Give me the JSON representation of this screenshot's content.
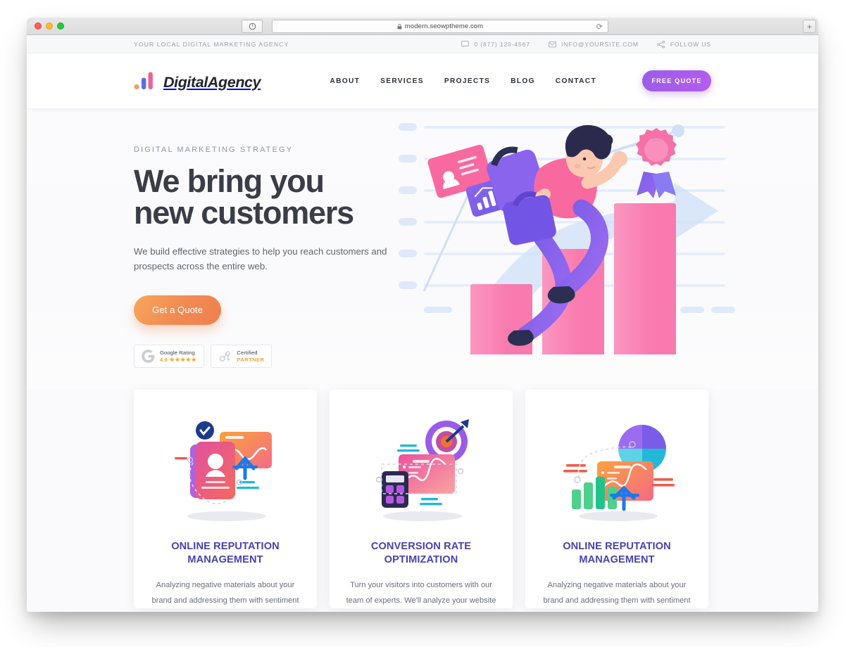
{
  "browser": {
    "url": "modern.seowptheme.com",
    "lock_icon": "lock-icon",
    "reload_icon": "reload-icon",
    "shield_icon": "shield-icon",
    "new_tab_label": "+"
  },
  "topbar": {
    "tagline": "YOUR LOCAL DIGITAL MARKETING AGENCY",
    "items": [
      {
        "icon": "chat-icon",
        "label": "0 (877) 123-4567"
      },
      {
        "icon": "mail-icon",
        "label": "INFO@YOURSITE.COM"
      },
      {
        "icon": "share-icon",
        "label": "FOLLOW US"
      }
    ]
  },
  "header": {
    "logo_text": "DigitalAgency",
    "logo_colors": {
      "dot": "#f5a14a",
      "bar_blue": "#5b6ce8",
      "bar_pink": "#f0619a"
    },
    "nav": [
      {
        "label": "ABOUT"
      },
      {
        "label": "SERVICES"
      },
      {
        "label": "PROJECTS"
      },
      {
        "label": "BLOG"
      },
      {
        "label": "CONTACT"
      }
    ],
    "cta_label": "FREE QUOTE",
    "cta_color": "#a85ced"
  },
  "hero": {
    "eyebrow": "DIGITAL MARKETING STRATEGY",
    "title_line1": "We bring you",
    "title_line2": "new customers",
    "subtitle": "We build effective strategies to help you reach customers and prospects across the entire web.",
    "cta_label": "Get a Quote",
    "cta_color": "#f08a52",
    "badges": [
      {
        "icon": "google-g-icon",
        "title": "Google Rating",
        "value": "4.9",
        "stars": "★★★★★"
      },
      {
        "icon": "hubspot-icon",
        "title": "Certified",
        "value": "PARTNER"
      }
    ],
    "illustration": "runner-on-growth-bars-illustration"
  },
  "services": {
    "cards": [
      {
        "icon": "profile-verified-chart-icon",
        "title": "ONLINE REPUTATION MANAGEMENT",
        "text": "Analyzing negative materials about your brand and addressing them with sentiment"
      },
      {
        "icon": "target-calculator-chart-icon",
        "title": "CONVERSION RATE OPTIMIZATION",
        "text": "Turn your visitors into customers with our team of experts. We'll analyze your website"
      },
      {
        "icon": "pie-bar-chart-icon",
        "title": "ONLINE REPUTATION MANAGEMENT",
        "text": "Analyzing negative materials about your brand and addressing them with sentiment"
      }
    ]
  }
}
